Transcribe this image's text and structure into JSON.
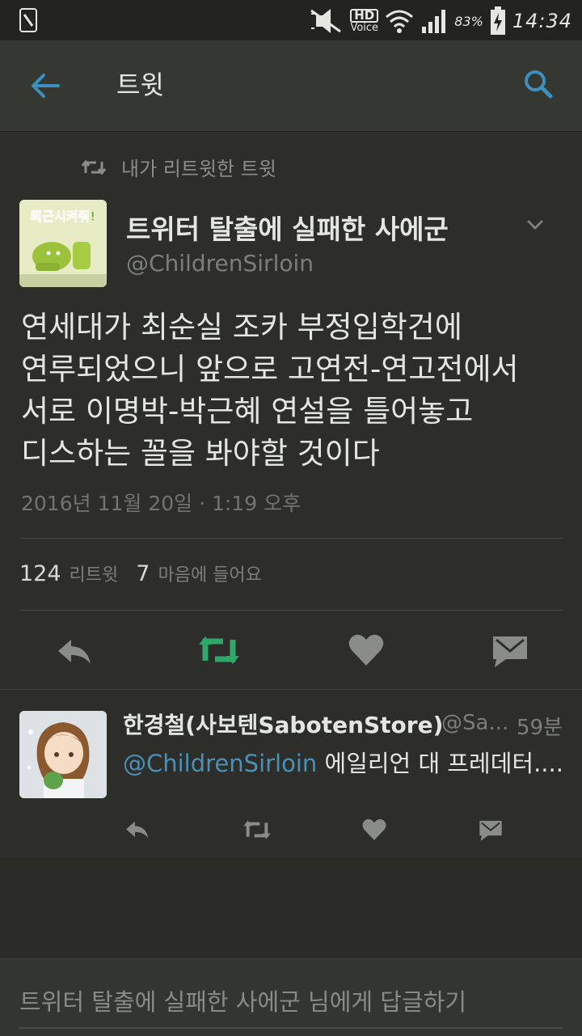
{
  "status_bar": {
    "hd_label": "HD",
    "voice_label": "Voice",
    "battery": "83%",
    "time": "14:34"
  },
  "app_bar": {
    "title": "트윗"
  },
  "tweet": {
    "retweet_context": "내가 리트윗한 트윗",
    "avatar_text": "퇴근시켜줘!",
    "author_name": "트위터 탈출에 실패한 사에군",
    "author_handle": "@ChildrenSirloin",
    "text_lines": [
      "연세대가 최순실 조카 부정입학건에",
      "연루되었으니 앞으로 고연전-연고전에서",
      "서로 이명박-박근혜 연설을 틀어놓고",
      "디스하는 꼴을 봐야할 것이다"
    ],
    "timestamp": "2016년 11월 20일 · 1:19 오후",
    "retweet_count": "124",
    "retweet_label": "리트윗",
    "like_count": "7",
    "like_label": "마음에 들어요"
  },
  "reply": {
    "author_name": "한경철(사보텐SabotenStore)",
    "author_handle": "@Sa...",
    "time": "59분",
    "mention": "@ChildrenSirloin",
    "text": " 에일리언 대 프레데터...."
  },
  "reply_bar": {
    "placeholder": "트위터 탈출에 실패한 사에군 님에게 답글하기"
  },
  "colors": {
    "accent_blue": "#3d8fc2",
    "retweet_green": "#2fa86a",
    "background": "#2d2e29"
  },
  "icons": [
    "back-arrow-icon",
    "search-icon",
    "retweet-icon",
    "chevron-down-icon",
    "reply-icon",
    "heart-icon",
    "message-icon"
  ]
}
